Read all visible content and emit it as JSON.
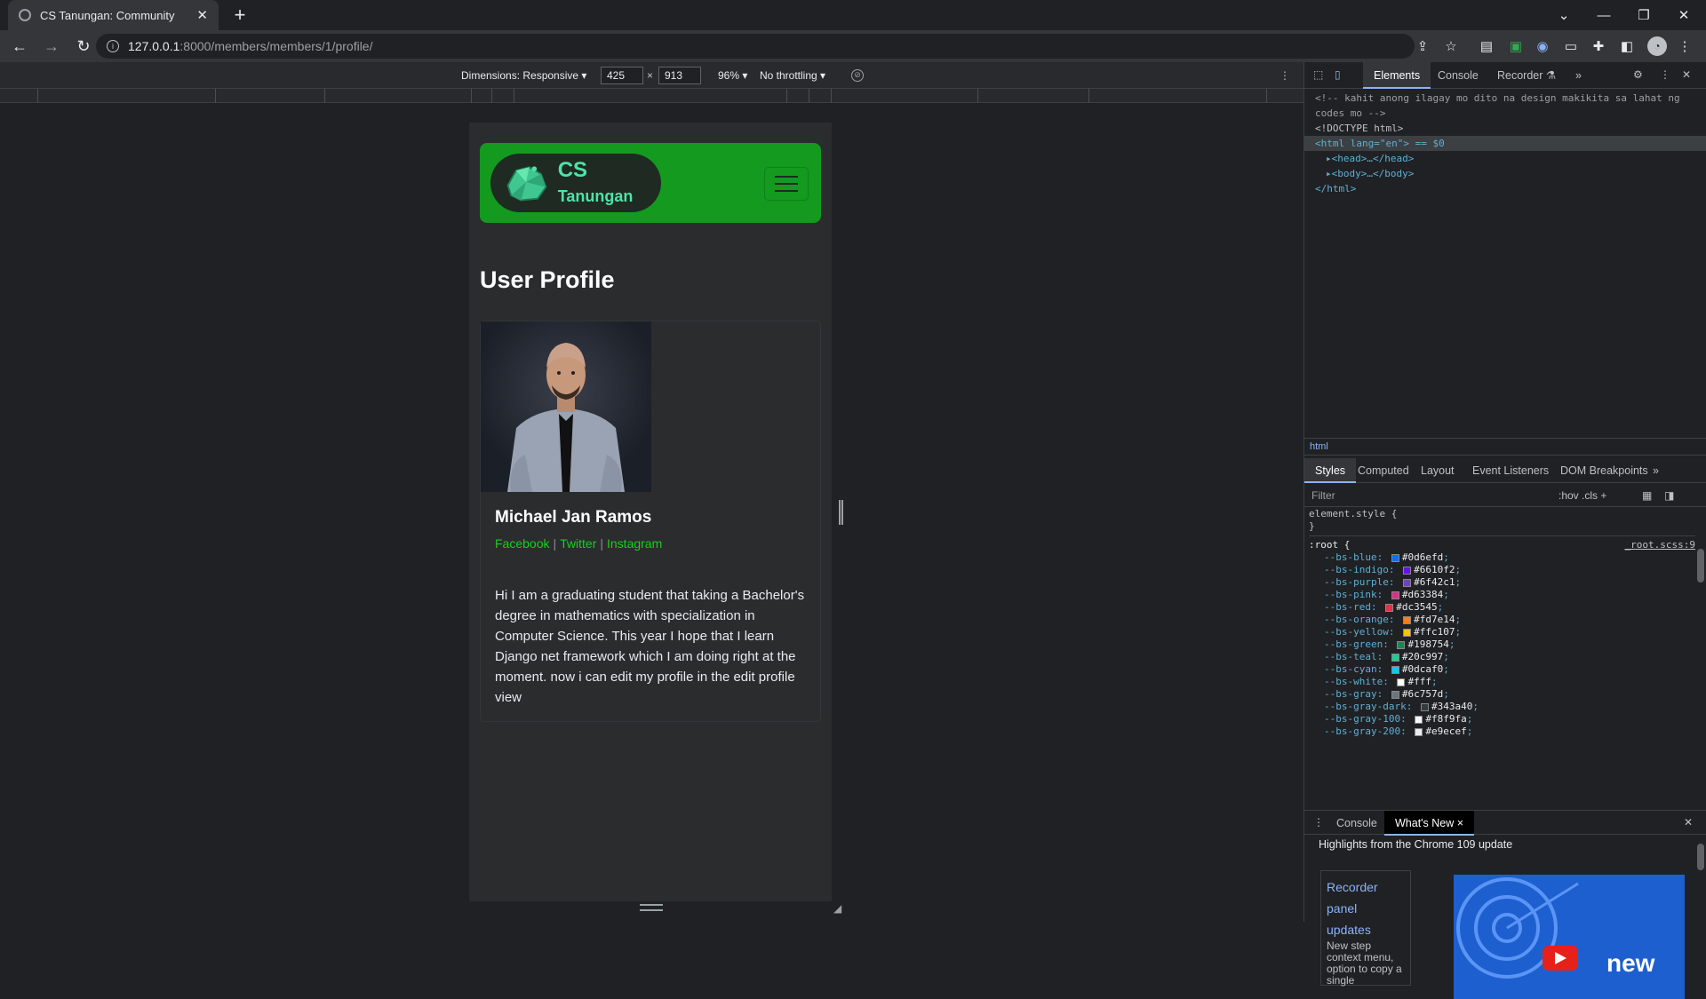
{
  "browser": {
    "tab_title": "CS Tanungan: Community",
    "url_host": "127.0.0.1",
    "url_path": ":8000/members/members/1/profile/"
  },
  "device_toolbar": {
    "dimensions_label": "Dimensions: Responsive ▾",
    "width": "425",
    "height": "913",
    "times": "×",
    "zoom": "96% ▾",
    "throttling": "No throttling ▾"
  },
  "site": {
    "brand_main": "CS",
    "brand_sub": "Tanungan",
    "page_title": "User Profile",
    "user_name": "Michael Jan Ramos",
    "social": [
      "Facebook",
      "Twitter",
      "Instagram"
    ],
    "social_sep": "|",
    "bio": "Hi I am a graduating student that taking a Bachelor's degree in mathematics with specialization in Computer Science. This year I hope that I learn Django net framework which I am doing right at the moment. now i can edit my profile in the edit profile view"
  },
  "devtools": {
    "tabs": [
      "Elements",
      "Console",
      "Recorder ⚗",
      "»"
    ],
    "dom_lines": {
      "comment1": "<!-- kahit anong ilagay mo dito na design makikita sa lahat ng",
      "comment2": "codes mo -->",
      "doctype": "<!DOCTYPE html>",
      "html_open": "<html lang=\"en\"> == $0",
      "head": "▸<head>…</head>",
      "body": "▸<body>…</body>",
      "html_close": "</html>"
    },
    "breadcrumb": "html",
    "style_tabs": [
      "Styles",
      "Computed",
      "Layout",
      "Event Listeners",
      "DOM Breakpoints",
      "»"
    ],
    "filter_placeholder": "Filter",
    "filter_tools": ":hov  .cls  +",
    "element_style_open": "element.style {",
    "element_style_close": "}",
    "root_selector": ":root {",
    "root_source": "_root.scss:9",
    "variables": [
      {
        "name": "--bs-blue",
        "value": "#0d6efd"
      },
      {
        "name": "--bs-indigo",
        "value": "#6610f2"
      },
      {
        "name": "--bs-purple",
        "value": "#6f42c1"
      },
      {
        "name": "--bs-pink",
        "value": "#d63384"
      },
      {
        "name": "--bs-red",
        "value": "#dc3545"
      },
      {
        "name": "--bs-orange",
        "value": "#fd7e14"
      },
      {
        "name": "--bs-yellow",
        "value": "#ffc107"
      },
      {
        "name": "--bs-green",
        "value": "#198754"
      },
      {
        "name": "--bs-teal",
        "value": "#20c997"
      },
      {
        "name": "--bs-cyan",
        "value": "#0dcaf0"
      },
      {
        "name": "--bs-white",
        "value": "#fff"
      },
      {
        "name": "--bs-gray",
        "value": "#6c757d"
      },
      {
        "name": "--bs-gray-dark",
        "value": "#343a40"
      },
      {
        "name": "--bs-gray-100",
        "value": "#f8f9fa"
      },
      {
        "name": "--bs-gray-200",
        "value": "#e9ecef"
      }
    ],
    "drawer_tabs": [
      "Console",
      "What's New ×"
    ],
    "highlights": "Highlights from the Chrome 109 update",
    "whatsnew_nav": [
      "Recorder",
      "panel",
      "updates"
    ],
    "whatsnew_sub": "New step context menu, option to copy a single",
    "promo_text": "new"
  }
}
